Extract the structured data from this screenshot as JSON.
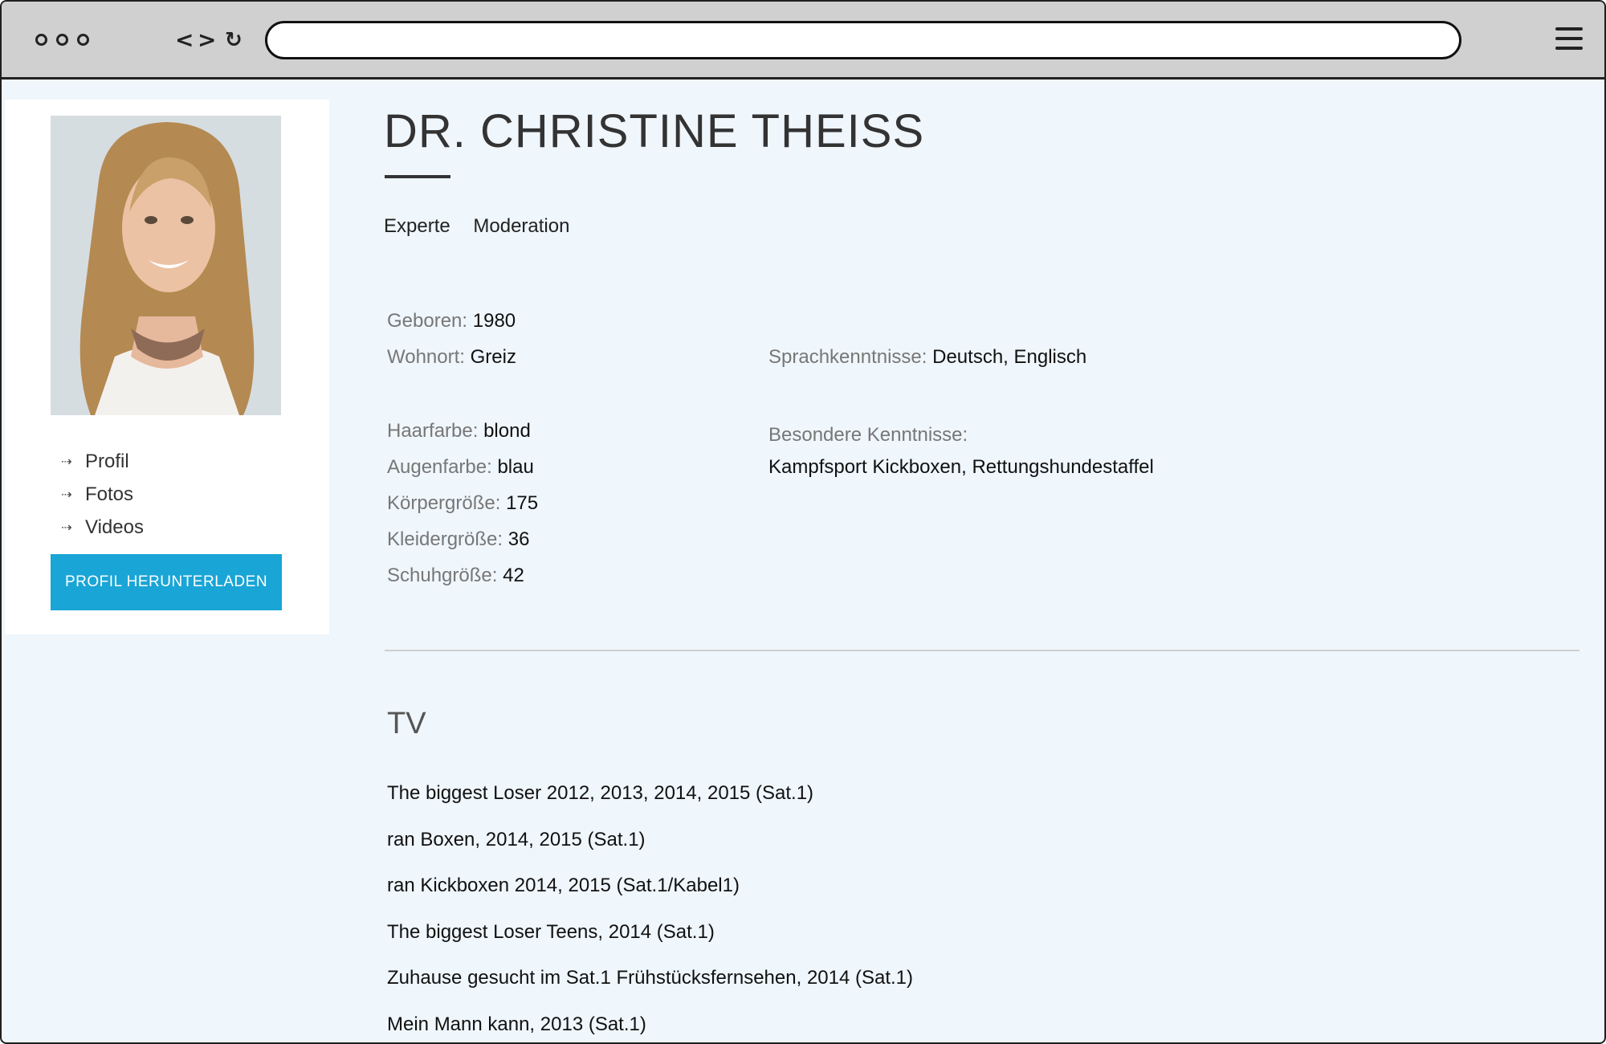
{
  "browser": {
    "url": "",
    "icons": [
      "window-dots-icon",
      "back-icon",
      "forward-icon",
      "reload-icon",
      "hamburger-menu-icon"
    ]
  },
  "sidebar": {
    "nav": [
      {
        "label": "Profil"
      },
      {
        "label": "Fotos"
      },
      {
        "label": "Videos"
      }
    ],
    "download_label": "PROFIL HERUNTERLADEN",
    "accent": "#19a5d6"
  },
  "profile": {
    "name": "DR. CHRISTINE THEISS",
    "tags": [
      "Experte",
      "Moderation"
    ],
    "geboren": {
      "label": "Geboren:",
      "value": "1980"
    },
    "wohnort": {
      "label": "Wohnort:",
      "value": "Greiz"
    },
    "sprache": {
      "label": "Sprachkenntnisse:",
      "value": "Deutsch, Englisch"
    },
    "haarfarbe": {
      "label": "Haarfarbe:",
      "value": "blond"
    },
    "augenfarbe": {
      "label": "Augenfarbe:",
      "value": "blau"
    },
    "koerpergroesse": {
      "label": "Körpergröße:",
      "value": "175"
    },
    "kleidergroesse": {
      "label": "Kleidergröße:",
      "value": "36"
    },
    "schuhgroesse": {
      "label": "Schuhgröße:",
      "value": "42"
    },
    "besondere": {
      "label": "Besondere Kenntnisse:",
      "value": "Kampfsport Kickboxen, Rettungshundestaffel"
    }
  },
  "tv": {
    "title": "TV",
    "items": [
      "The biggest Loser 2012, 2013, 2014, 2015 (Sat.1)",
      "ran Boxen, 2014, 2015 (Sat.1)",
      "ran Kickboxen 2014, 2015 (Sat.1/Kabel1)",
      "The biggest Loser Teens, 2014 (Sat.1)",
      "Zuhause gesucht im Sat.1 Frühstücksfernsehen, 2014 (Sat.1)",
      "Mein Mann kann, 2013 (Sat.1)"
    ]
  }
}
